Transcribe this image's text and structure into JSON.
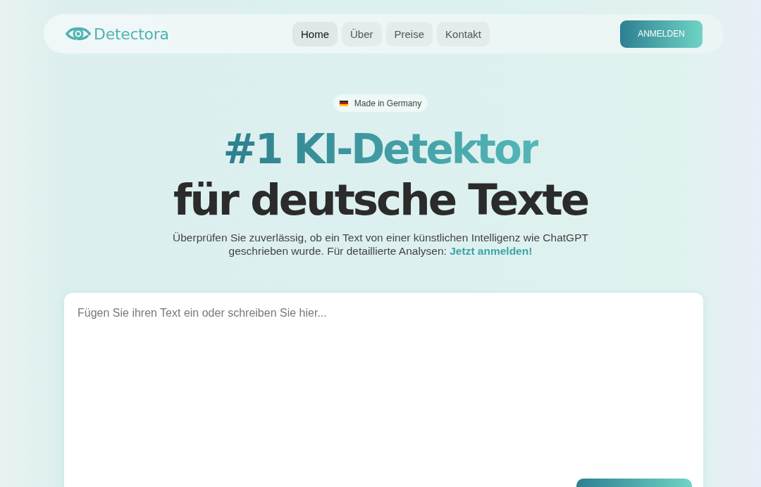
{
  "header": {
    "logo": "Detectora",
    "nav": [
      {
        "label": "Home",
        "selected": true
      },
      {
        "label": "Über",
        "selected": false
      },
      {
        "label": "Preise",
        "selected": false
      },
      {
        "label": "Kontakt",
        "selected": false
      }
    ],
    "login_button": "ANMELDEN"
  },
  "hero": {
    "badge": "Made in Germany",
    "title_line_1": "#1 KI-Detektor",
    "title_line_2": "für deutsche Texte",
    "subtitle": "Überprüfen Sie zuverlässig, ob ein Text von einer künstlichen Intelligenz wie ChatGPT geschrieben wurde. Für detaillierte Analysen: ",
    "subtitle_link": "Jetzt anmelden!"
  },
  "editor": {
    "placeholder": "Fügen Sie ihren Text ein oder schreiben Sie hier..."
  }
}
